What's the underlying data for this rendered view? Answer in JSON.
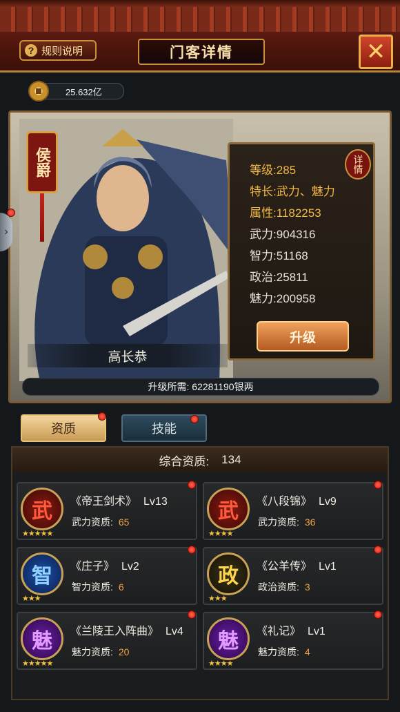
{
  "header": {
    "rules_label": "规则说明",
    "title": "门客详情",
    "close_icon": "close-icon"
  },
  "currency": {
    "icon": "coin-icon",
    "value": "25.632亿"
  },
  "hero": {
    "rank": "侯爵",
    "name": "高长恭",
    "detail_label": "详情",
    "stats": [
      {
        "label": "等级:",
        "value": "285",
        "highlight": true
      },
      {
        "label": "特长:",
        "value": "武力、魅力",
        "highlight": true
      },
      {
        "label": "属性:",
        "value": "1182253",
        "highlight": true
      },
      {
        "label": "武力:",
        "value": "904316",
        "highlight": false
      },
      {
        "label": "智力:",
        "value": "51168",
        "highlight": false
      },
      {
        "label": "政治:",
        "value": "25811",
        "highlight": false
      },
      {
        "label": "魅力:",
        "value": "200958",
        "highlight": false
      }
    ],
    "upgrade_label": "升级",
    "upgrade_cost": "升级所需: 62281190银两"
  },
  "tabs": [
    {
      "label": "资质",
      "active": true
    },
    {
      "label": "技能",
      "active": false
    }
  ],
  "aptitude": {
    "total_label": "综合资质:",
    "total_value": "134",
    "cards": [
      {
        "icon_char": "武",
        "icon_type": "wu",
        "stars": 5,
        "name": "《帝王剑术》",
        "level": "Lv13",
        "attr_label": "武力资质:",
        "attr_value": "65"
      },
      {
        "icon_char": "武",
        "icon_type": "wu",
        "stars": 4,
        "name": "《八段锦》",
        "level": "Lv9",
        "attr_label": "武力资质:",
        "attr_value": "36"
      },
      {
        "icon_char": "智",
        "icon_type": "zhi",
        "stars": 3,
        "name": "《庄子》",
        "level": "Lv2",
        "attr_label": "智力资质:",
        "attr_value": "6"
      },
      {
        "icon_char": "政",
        "icon_type": "zheng",
        "stars": 3,
        "name": "《公羊传》",
        "level": "Lv1",
        "attr_label": "政治资质:",
        "attr_value": "3"
      },
      {
        "icon_char": "魅",
        "icon_type": "mei",
        "stars": 5,
        "name": "《兰陵王入阵曲》",
        "level": "Lv4",
        "attr_label": "魅力资质:",
        "attr_value": "20"
      },
      {
        "icon_char": "魅",
        "icon_type": "mei",
        "stars": 4,
        "name": "《礼记》",
        "level": "Lv1",
        "attr_label": "魅力资质:",
        "attr_value": "4"
      }
    ]
  },
  "colors": {
    "accent_gold": "#f2b742",
    "notify_red": "#d8170b",
    "panel_border": "#8a6a3d"
  }
}
